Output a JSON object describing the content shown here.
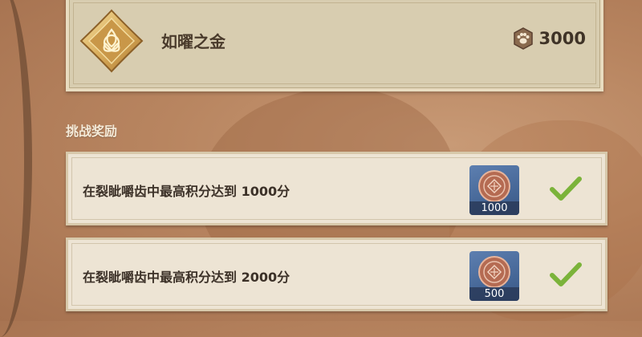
{
  "top_card": {
    "reward_name": "如曜之金",
    "cost": "3000",
    "cost_icon": "paw-token-icon",
    "emblem_icon": "gold-triquetra-emblem-icon"
  },
  "section_title": "挑战奖励",
  "rewards": [
    {
      "description": "在裂眦嚼齿中最高积分达到 1000分",
      "item_count": "1000",
      "item_icon": "copper-coin-icon",
      "claimed_icon": "check-icon"
    },
    {
      "description": "在裂眦嚼齿中最高积分达到 2000分",
      "item_count": "500",
      "item_icon": "copper-coin-icon",
      "claimed_icon": "check-icon"
    }
  ],
  "colors": {
    "check_green": "#7bb33a",
    "tile_blue": "#4a6b9c",
    "card_bg": "#d8cdb0",
    "row_bg": "#ede4d4"
  }
}
